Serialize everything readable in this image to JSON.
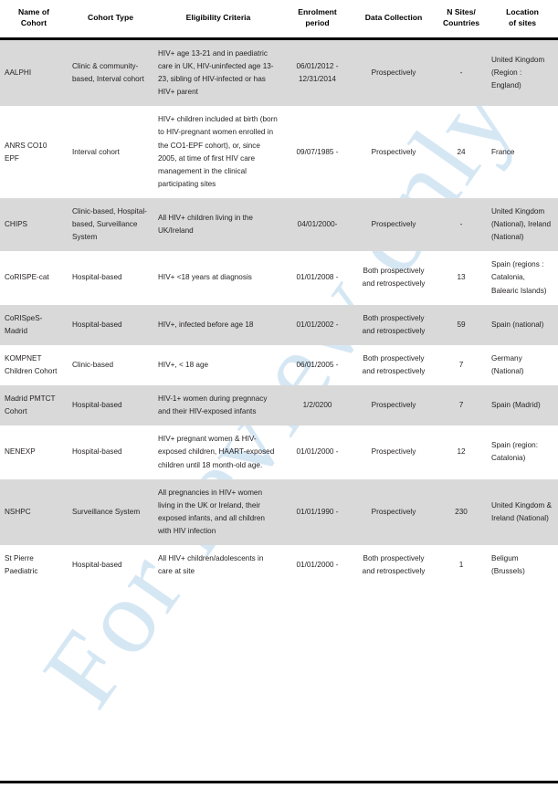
{
  "watermark": {
    "text": "For review only"
  },
  "table": {
    "columns": [
      {
        "id": "name",
        "label": "Name of\nCohort"
      },
      {
        "id": "type",
        "label": "Cohort Type"
      },
      {
        "id": "elig",
        "label": "Eligibility Criteria"
      },
      {
        "id": "enrol",
        "label": "Enrolment\nperiod"
      },
      {
        "id": "data",
        "label": "Data Collection"
      },
      {
        "id": "sites",
        "label": "N Sites/\nCountries"
      },
      {
        "id": "loc",
        "label": "Location\nof sites"
      }
    ],
    "header": {
      "name_line1": "Name of",
      "name_line2": "Cohort",
      "type": "Cohort Type",
      "elig": "Eligibility Criteria",
      "enrol_line1": "Enrolment",
      "enrol_line2": "period",
      "data": "Data Collection",
      "sites_line1": "N Sites/",
      "sites_line2": "Countries",
      "loc_line1": "Location",
      "loc_line2": "of sites"
    },
    "rows": [
      {
        "shaded": true,
        "name": "AALPHI",
        "type": "Clinic & community-based, Interval cohort",
        "eligibility": "HIV+ age 13-21 and in paediatric care in UK, HIV-uninfected age 13-23, sibling of HIV-infected or has HIV+ parent",
        "enrolment": "06/01/2012 - 12/31/2014",
        "data_collection": "Prospectively",
        "n_sites": "-",
        "location": "United Kingdom (Region : England)"
      },
      {
        "shaded": false,
        "name": "ANRS CO10 EPF",
        "type": "Interval cohort",
        "eligibility": "HIV+ children included at birth (born to HIV-pregnant women enrolled in the CO1-EPF cohort), or, since 2005, at time of first HIV care management in the clinical participating sites",
        "enrolment": "09/07/1985 -",
        "data_collection": "Prospectively",
        "n_sites": "24",
        "location": "France"
      },
      {
        "shaded": true,
        "name": "CHIPS",
        "type": "Clinic-based, Hospital-based, Surveillance System",
        "eligibility": "All HIV+ children living in the UK/Ireland",
        "enrolment": "04/01/2000-",
        "data_collection": "Prospectively",
        "n_sites": "-",
        "location": "United Kingdom (National), Ireland (National)"
      },
      {
        "shaded": false,
        "name": "CoRISPE-cat",
        "type": "Hospital-based",
        "eligibility": "HIV+ <18 years at diagnosis",
        "enrolment": "01/01/2008 -",
        "data_collection": "Both prospectively and retrospectively",
        "n_sites": "13",
        "location": "Spain (regions : Catalonia, Balearic Islands)"
      },
      {
        "shaded": true,
        "name": "CoRISpeS-Madrid",
        "type": "Hospital-based",
        "eligibility": "HIV+, infected before age 18",
        "enrolment": "01/01/2002 -",
        "data_collection": "Both prospectively and retrospectively",
        "n_sites": "59",
        "location": "Spain (national)"
      },
      {
        "shaded": false,
        "name": "KOMPNET Children Cohort",
        "type": "Clinic-based",
        "eligibility": "HIV+, < 18 age",
        "enrolment": "06/01/2005 -",
        "data_collection": "Both prospectively and retrospectively",
        "n_sites": "7",
        "location": "Germany (National)"
      },
      {
        "shaded": true,
        "name": "Madrid PMTCT Cohort",
        "type": "Hospital-based",
        "eligibility": "HIV-1+ women during pregnnacy and their HIV-exposed infants",
        "enrolment": "1/2/0200",
        "data_collection": "Prospectively",
        "n_sites": "7",
        "location": "Spain (Madrid)"
      },
      {
        "shaded": false,
        "name": "NENEXP",
        "type": "Hospital-based",
        "eligibility": "HIV+ pregnant women & HIV-exposed children, HAART-exposed children until 18 month-old age.",
        "enrolment": "01/01/2000 -",
        "data_collection": "Prospectively",
        "n_sites": "12",
        "location": "Spain (region: Catalonia)"
      },
      {
        "shaded": true,
        "name": "NSHPC",
        "type": "Surveillance System",
        "eligibility": "All pregnancies in HIV+ women living in the UK or Ireland, their exposed infants, and all children with HIV infection",
        "enrolment": "01/01/1990 -",
        "data_collection": "Prospectively",
        "n_sites": "230",
        "location": "United Kingdom & Ireland (National)"
      },
      {
        "shaded": false,
        "name": "St Pierre Paediatric",
        "type": "Hospital-based",
        "eligibility": "All HIV+ children/adolescents in care at site",
        "enrolment": "01/01/2000 -",
        "data_collection": "Both prospectively and retrospectively",
        "n_sites": "1",
        "location": "Beligum (Brussels)"
      }
    ]
  }
}
